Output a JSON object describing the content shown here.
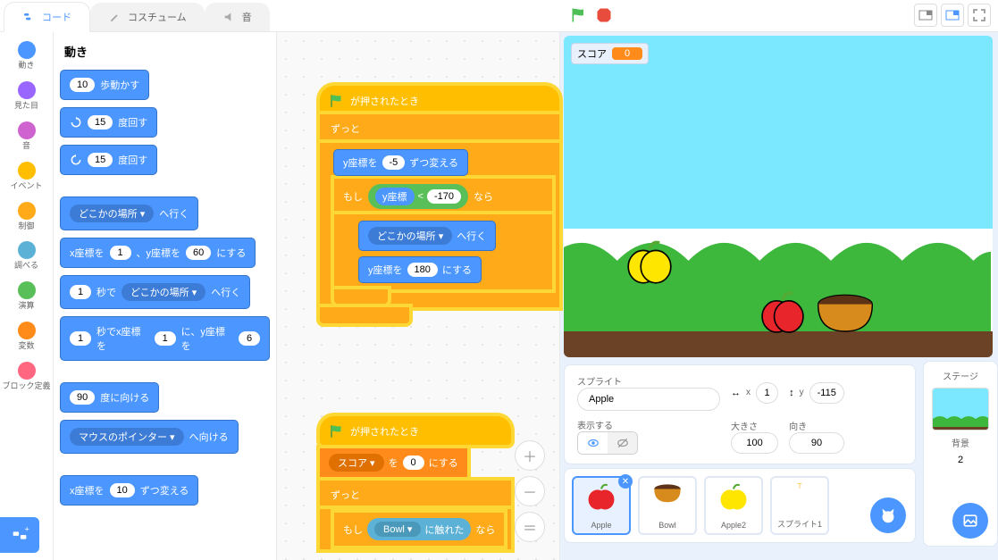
{
  "tabs": {
    "code": "コード",
    "costumes": "コスチューム",
    "sounds": "音"
  },
  "categories": [
    {
      "label": "動き",
      "color": "#4c97ff"
    },
    {
      "label": "見た目",
      "color": "#9966ff"
    },
    {
      "label": "音",
      "color": "#cf63cf"
    },
    {
      "label": "イベント",
      "color": "#ffbf00"
    },
    {
      "label": "制御",
      "color": "#ffab19"
    },
    {
      "label": "調べる",
      "color": "#5cb1d6"
    },
    {
      "label": "演算",
      "color": "#59c059"
    },
    {
      "label": "変数",
      "color": "#ff8c1a"
    },
    {
      "label": "ブロック定義",
      "color": "#ff6680"
    }
  ],
  "palette": {
    "title": "動き",
    "blocks": {
      "move_steps": {
        "val": "10",
        "suffix": "歩動かす"
      },
      "turn_cw": {
        "val": "15",
        "suffix": "度回す"
      },
      "turn_ccw": {
        "val": "15",
        "suffix": "度回す"
      },
      "goto_menu": {
        "menu": "どこかの場所",
        "suffix": "へ行く"
      },
      "goto_xy": {
        "prefix": "x座標を",
        "x": "1",
        "mid": "、y座標を",
        "y": "60",
        "suffix": "にする"
      },
      "glide_menu": {
        "secs": "1",
        "mid": "秒で",
        "menu": "どこかの場所",
        "suffix": "へ行く"
      },
      "glide_xy": {
        "secs": "1",
        "mid": "秒でx座標を",
        "x": "1",
        "mid2": "に、y座標を",
        "y": "6"
      },
      "point_dir": {
        "val": "90",
        "suffix": "度に向ける"
      },
      "point_to": {
        "menu": "マウスのポインター",
        "suffix": "へ向ける"
      },
      "change_x": {
        "prefix": "x座標を",
        "val": "10",
        "suffix": "ずつ変える"
      }
    }
  },
  "script1": {
    "hat": "が押されたとき",
    "forever": "ずっと",
    "change_y": {
      "prefix": "y座標を",
      "val": "-5",
      "suffix": "ずつ変える"
    },
    "if": {
      "prefix": "もし",
      "cond_left": "y座標",
      "op": "<",
      "cond_right": "-170",
      "suffix": "なら"
    },
    "goto": {
      "menu": "どこかの場所",
      "suffix": "へ行く"
    },
    "set_y": {
      "prefix": "y座標を",
      "val": "180",
      "suffix": "にする"
    }
  },
  "script2": {
    "hat": "が押されたとき",
    "set_var": {
      "menu": "スコア",
      "mid": "を",
      "val": "0",
      "suffix": "にする"
    },
    "forever": "ずっと",
    "if": {
      "prefix": "もし",
      "menu": "Bowl",
      "mid": "に触れた",
      "suffix": "なら"
    }
  },
  "stage": {
    "score_label": "スコア",
    "score_value": "0"
  },
  "sprite_info": {
    "sprite_label": "スプライト",
    "name": "Apple",
    "x_label": "x",
    "x": "1",
    "y_label": "y",
    "y": "-115",
    "show_label": "表示する",
    "size_label": "大きさ",
    "size": "100",
    "dir_label": "向き",
    "dir": "90"
  },
  "sprites": [
    {
      "name": "Apple"
    },
    {
      "name": "Bowl"
    },
    {
      "name": "Apple2"
    },
    {
      "name": "スプライト1"
    }
  ],
  "stage_panel": {
    "title": "ステージ",
    "backdrop_label": "背景",
    "backdrop_count": "2"
  }
}
